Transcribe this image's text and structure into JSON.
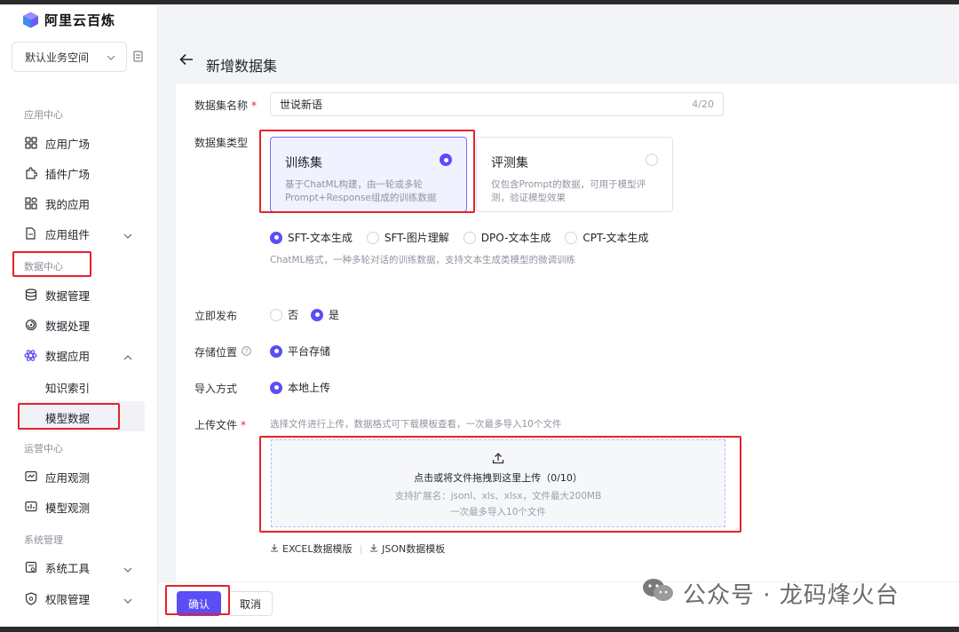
{
  "app": {
    "name": "阿里云百炼"
  },
  "workspace": {
    "label": "默认业务空间"
  },
  "sidebar": {
    "sections": {
      "app_center": "应用中心",
      "data_center": "数据中心",
      "ops_center": "运营中心",
      "system": "系统管理"
    },
    "items": {
      "app_plaza": "应用广场",
      "plugin_plaza": "插件广场",
      "my_apps": "我的应用",
      "app_components": "应用组件",
      "data_management": "数据管理",
      "data_processing": "数据处理",
      "data_application": "数据应用",
      "knowledge_index": "知识索引",
      "model_data": "模型数据",
      "app_observe": "应用观测",
      "model_observe": "模型观测",
      "system_tools": "系统工具",
      "permission_mgmt": "权限管理"
    }
  },
  "page": {
    "title": "新增数据集",
    "fields": {
      "name_label": "数据集名称",
      "name_value": "世说新语",
      "name_count": "4/20",
      "type_label": "数据集类型",
      "publish_label": "立即发布",
      "storage_label": "存储位置",
      "import_label": "导入方式",
      "upload_label": "上传文件"
    },
    "type_cards": {
      "train_title": "训练集",
      "train_desc": "基于ChatML构建，由一轮或多轮Prompt+Response组成的训练数据",
      "eval_title": "评测集",
      "eval_desc": "仅包含Prompt的数据，可用于模型评测，验证模型效果"
    },
    "subtypes": [
      "SFT-文本生成",
      "SFT-图片理解",
      "DPO-文本生成",
      "CPT-文本生成"
    ],
    "subtype_hint": "ChatML格式，一种多轮对话的训练数据，支持文本生成类模型的微调训练",
    "publish_options": {
      "no": "否",
      "yes": "是"
    },
    "storage_option": "平台存储",
    "import_option": "本地上传",
    "upload_hint": "选择文件进行上传，数据格式可下载模板查看，一次最多导入10个文件",
    "upload_area": {
      "line1": "点击或将文件拖拽到这里上传（0/10）",
      "line2": "支持扩展名：jsonl、xls、xlsx，文件最大200MB",
      "line3": "一次最多导入10个文件"
    },
    "templates": {
      "excel": "EXCEL数据模版",
      "json": "JSON数据模板"
    }
  },
  "buttons": {
    "confirm": "确认",
    "cancel": "取消"
  },
  "watermark": {
    "text": "公众号 · 龙码烽火台"
  },
  "colors": {
    "accent": "#5b4ef5",
    "highlight": "#e5222b"
  }
}
